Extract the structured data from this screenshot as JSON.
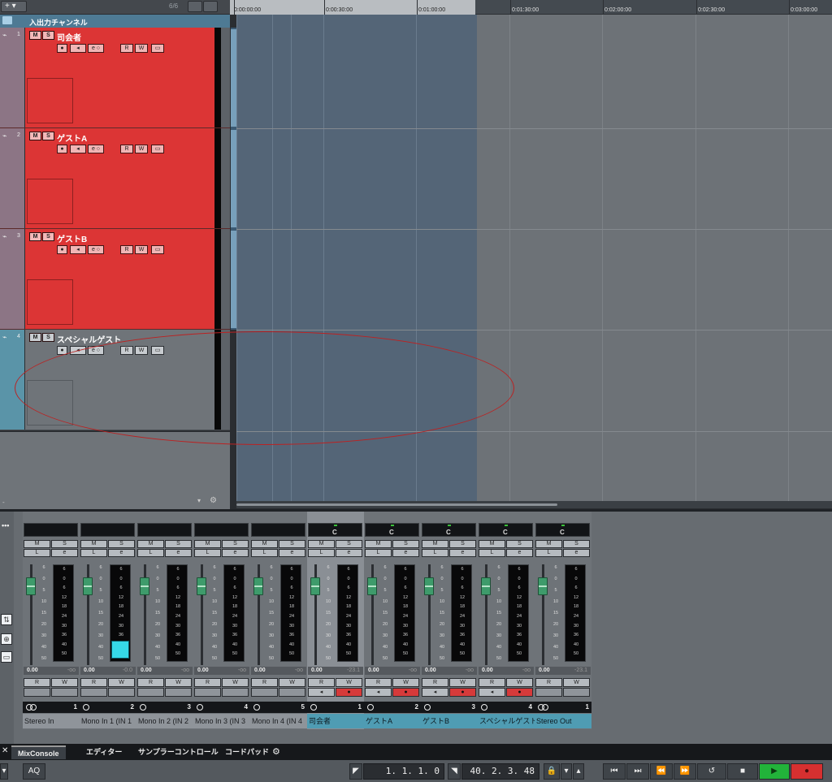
{
  "project": {
    "add_button": "+ ▾",
    "track_count": "6/6",
    "io_folder_label": "入出力チャンネル"
  },
  "tracks": [
    {
      "num": "1",
      "name": "司会者"
    },
    {
      "num": "2",
      "name": "ゲストA"
    },
    {
      "num": "3",
      "name": "ゲストB"
    },
    {
      "num": "4",
      "name": "スペシャルゲスト"
    }
  ],
  "track_buttons": {
    "mute": "M",
    "solo": "S",
    "read": "R",
    "write": "W"
  },
  "ruler": {
    "labels": [
      "0:00:00:00",
      "0:00:30:00",
      "0:01:00:00",
      "0:01:30:00",
      "0:02:00:00",
      "0:02:30:00",
      "0:03:00:00"
    ]
  },
  "mixer": {
    "side_icons": [
      "⇅",
      "⊕",
      "▭"
    ],
    "menu_dots": "•••",
    "strips": [
      {
        "name": "Stereo In",
        "num": "1",
        "vol": "0.00",
        "peak": "-oo",
        "pan": "",
        "stereo": true
      },
      {
        "name": "Mono In 1 (IN 1",
        "num": "2",
        "vol": "0.00",
        "peak": "-0.0",
        "pan": "",
        "stereo": false
      },
      {
        "name": "Mono In 2 (IN 2",
        "num": "3",
        "vol": "0.00",
        "peak": "-oo",
        "pan": "",
        "stereo": false
      },
      {
        "name": "Mono In 3 (IN 3",
        "num": "4",
        "vol": "0.00",
        "peak": "-oo",
        "pan": "",
        "stereo": false
      },
      {
        "name": "Mono In 4 (IN 4",
        "num": "5",
        "vol": "0.00",
        "peak": "-oo",
        "pan": "",
        "stereo": false
      },
      {
        "name": "司会者",
        "num": "1",
        "vol": "0.00",
        "peak": "-23.1",
        "pan": "C",
        "stereo": false
      },
      {
        "name": "ゲストA",
        "num": "2",
        "vol": "0.00",
        "peak": "-oo",
        "pan": "C",
        "stereo": false
      },
      {
        "name": "ゲストB",
        "num": "3",
        "vol": "0.00",
        "peak": "-oo",
        "pan": "C",
        "stereo": false
      },
      {
        "name": "スペシャルゲスト",
        "num": "4",
        "vol": "0.00",
        "peak": "-oo",
        "pan": "C",
        "stereo": false
      },
      {
        "name": "Stereo Out",
        "num": "1",
        "vol": "0.00",
        "peak": "-23.1",
        "pan": "C",
        "stereo": true
      }
    ],
    "fader_scale": [
      "6",
      "0",
      "5",
      "10",
      "15",
      "20",
      "30",
      "40",
      "50"
    ],
    "meter_scale": [
      "6",
      "0",
      "6",
      "12",
      "18",
      "24",
      "30",
      "36",
      "40",
      "50"
    ],
    "buttons": {
      "m": "M",
      "s": "S",
      "l": "L",
      "e": "e",
      "r": "R",
      "w": "W"
    }
  },
  "tabs": {
    "mixconsole": "MixConsole",
    "editor": "エディター",
    "sampler": "サンプラーコントロール",
    "chordpad": "コードパッド"
  },
  "transport": {
    "aq": "AQ",
    "left_locator": "1. 1. 1.   0",
    "right_locator": "40. 2. 3. 48"
  },
  "colors": {
    "track_red": "#dc3535",
    "track_selected_gray": "#6f7479",
    "track_color_strip_blue": "#5a94a8",
    "meter_level": "#36d8e8",
    "play": "#22b33a",
    "record": "#d63030"
  }
}
